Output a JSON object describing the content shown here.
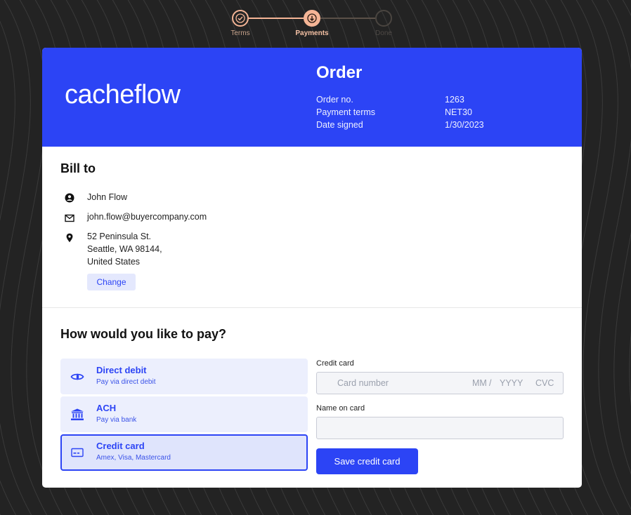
{
  "stepper": {
    "steps": [
      {
        "label": "Terms",
        "state": "complete"
      },
      {
        "label": "Payments",
        "state": "current"
      },
      {
        "label": "Done",
        "state": "upcoming"
      }
    ]
  },
  "brand": {
    "logo_text": "cacheflow",
    "accent_color": "#2c44f5",
    "step_color": "#f5b596"
  },
  "order": {
    "title": "Order",
    "rows": [
      {
        "label": "Order no.",
        "value": "1263"
      },
      {
        "label": "Payment terms",
        "value": "NET30"
      },
      {
        "label": "Date signed",
        "value": "1/30/2023"
      }
    ]
  },
  "bill_to": {
    "title": "Bill to",
    "name": "John Flow",
    "email": "john.flow@buyercompany.com",
    "address_lines": [
      "52 Peninsula St.",
      "Seattle, WA 98144,",
      "United States"
    ],
    "change_label": "Change",
    "icons": [
      "person-icon",
      "mail-icon",
      "location-pin-icon"
    ]
  },
  "payment": {
    "title": "How would you like to pay?",
    "options": [
      {
        "name": "Direct debit",
        "desc": "Pay via direct debit",
        "icon": "direct-debit-icon",
        "selected": false
      },
      {
        "name": "ACH",
        "desc": "Pay via bank",
        "icon": "bank-icon",
        "selected": false
      },
      {
        "name": "Credit card",
        "desc": "Amex, Visa, Mastercard",
        "icon": "credit-card-icon",
        "selected": true
      }
    ]
  },
  "card_form": {
    "credit_card_label": "Credit card",
    "card_number_placeholder": "Card number",
    "mm_placeholder": "MM",
    "separator": "/",
    "yyyy_placeholder": "YYYY",
    "cvc_placeholder": "CVC",
    "name_label": "Name on card",
    "name_value": "",
    "save_label": "Save credit card"
  }
}
